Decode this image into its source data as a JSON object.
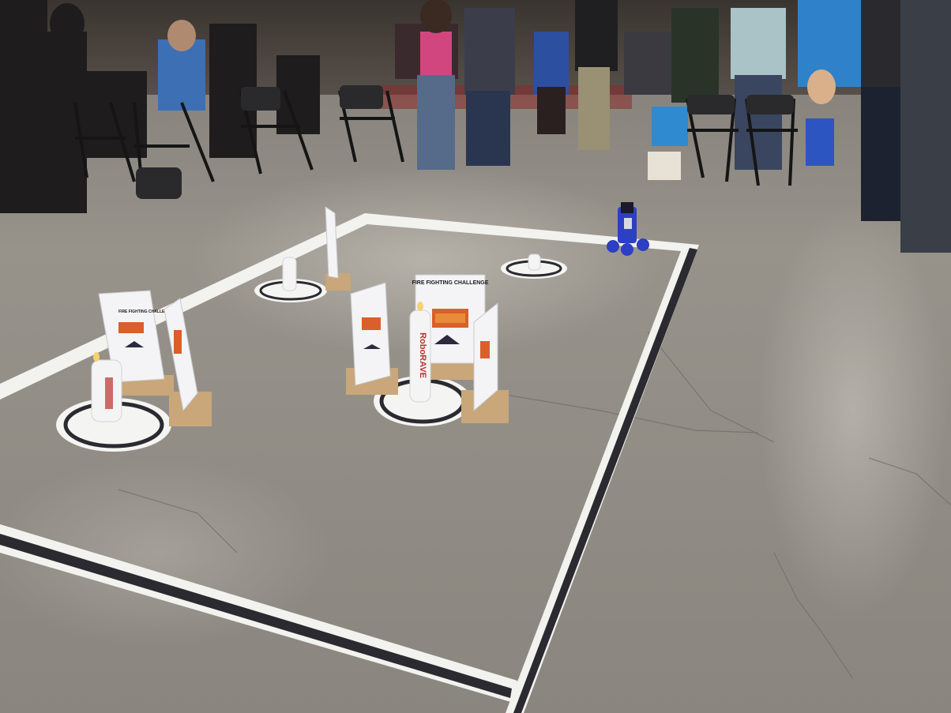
{
  "photo": {
    "sign_text": "FIRE FIGHTING CHALLENGE",
    "candle_brand": "RoboRAVE"
  },
  "colors": {
    "floor": "#8f8b84",
    "tape_white": "#f2f2ee",
    "tape_black": "#2a2a30",
    "sign_board": "#f4f4f6",
    "fire": "#d9602a",
    "wood": "#c9a77a",
    "robot": "#2d3fc2"
  }
}
